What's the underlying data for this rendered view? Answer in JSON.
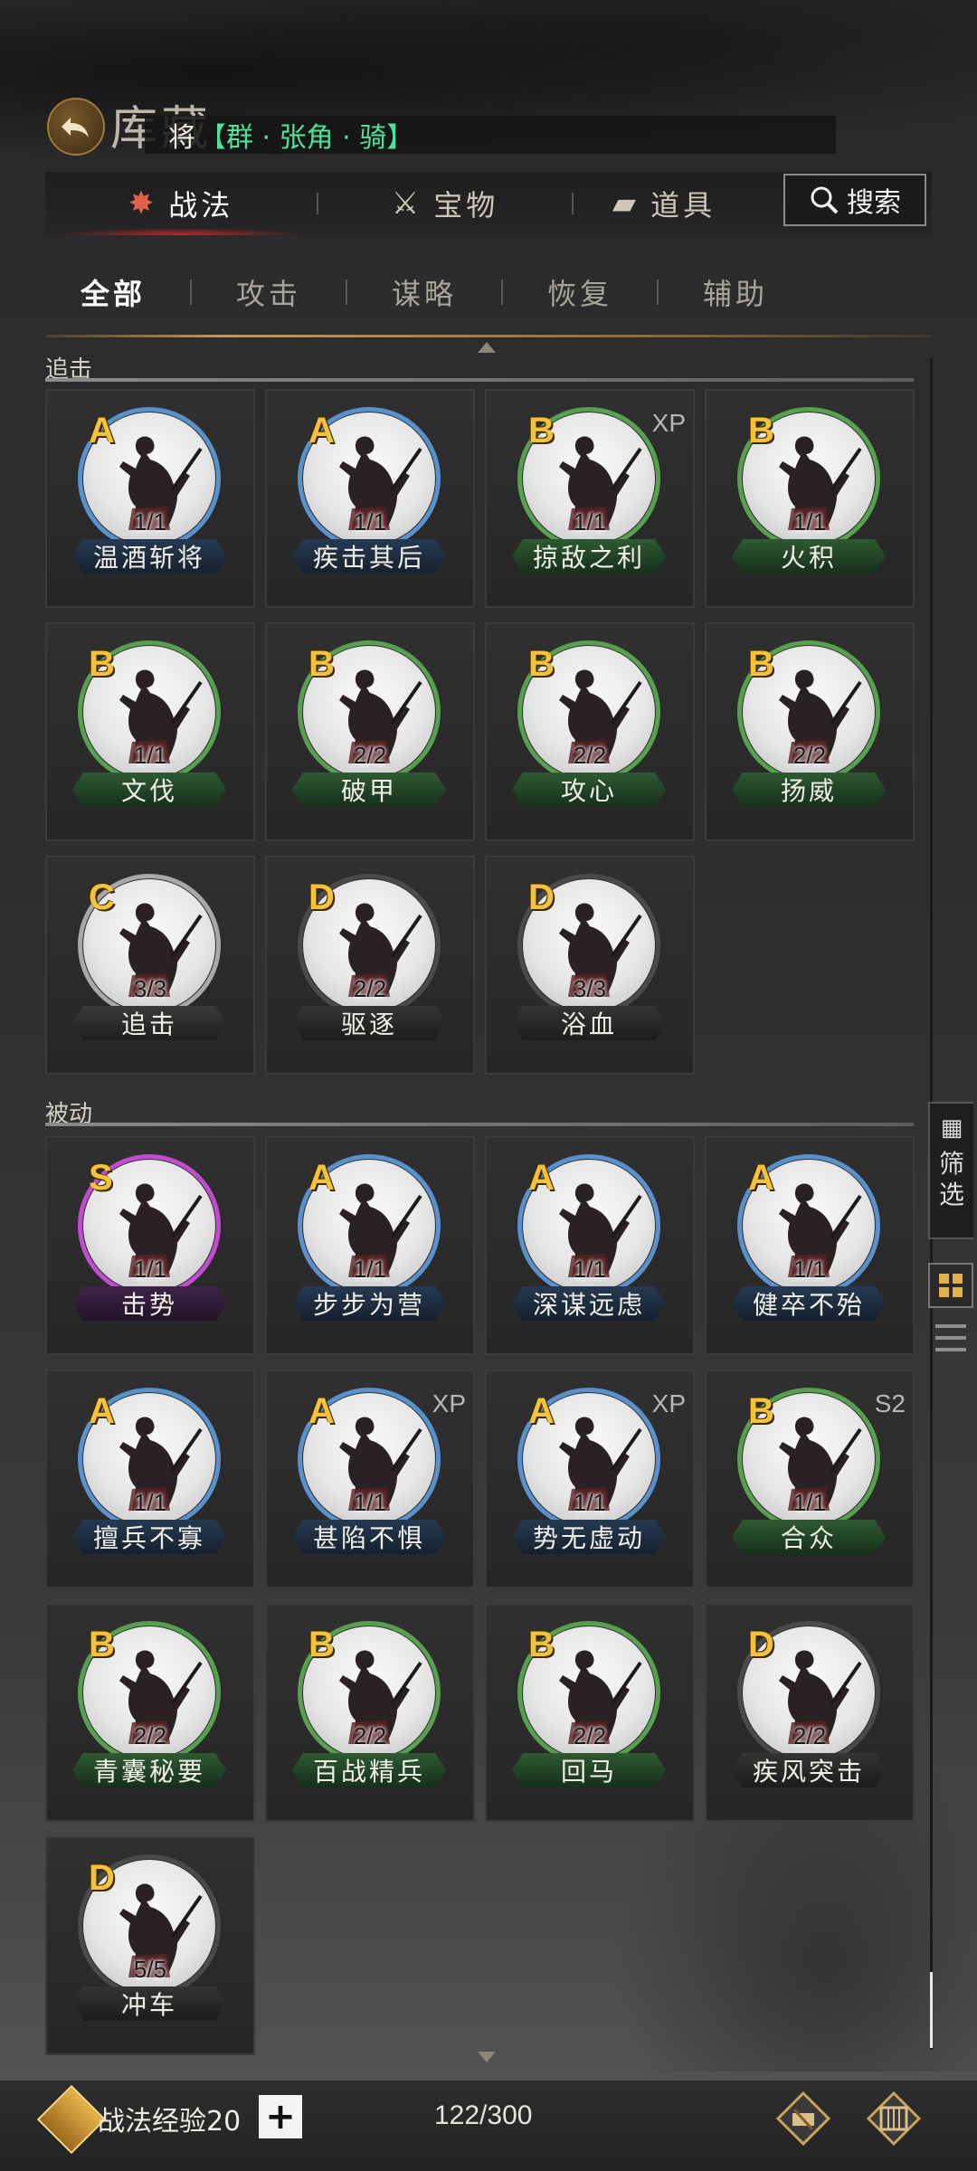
{
  "header": {
    "title": "库藏",
    "general_prefix": "将",
    "general_faction": "【群 · 张角 · 骑】"
  },
  "category_tabs": [
    {
      "label": "战法",
      "icon": "scroll-icon",
      "active": true
    },
    {
      "label": "宝物",
      "icon": "treasure-icon",
      "active": false
    },
    {
      "label": "道具",
      "icon": "item-box-icon",
      "active": false
    }
  ],
  "search": {
    "label": "搜索",
    "icon": "search-icon"
  },
  "filter_tabs": [
    {
      "label": "全部",
      "active": true
    },
    {
      "label": "攻击",
      "active": false
    },
    {
      "label": "谋略",
      "active": false
    },
    {
      "label": "恢复",
      "active": false
    },
    {
      "label": "辅助",
      "active": false
    }
  ],
  "sections": [
    {
      "title": "追击",
      "items": [
        {
          "grade": "A",
          "count": "1/1",
          "name": "温酒斩将",
          "tag": ""
        },
        {
          "grade": "A",
          "count": "1/1",
          "name": "疾击其后",
          "tag": ""
        },
        {
          "grade": "B",
          "count": "1/1",
          "name": "掠敌之利",
          "tag": "XP"
        },
        {
          "grade": "B",
          "count": "1/1",
          "name": "火积",
          "tag": ""
        },
        {
          "grade": "B",
          "count": "1/1",
          "name": "文伐",
          "tag": ""
        },
        {
          "grade": "B",
          "count": "2/2",
          "name": "破甲",
          "tag": ""
        },
        {
          "grade": "B",
          "count": "2/2",
          "name": "攻心",
          "tag": ""
        },
        {
          "grade": "B",
          "count": "2/2",
          "name": "扬威",
          "tag": ""
        },
        {
          "grade": "C",
          "count": "3/3",
          "name": "追击",
          "tag": ""
        },
        {
          "grade": "D",
          "count": "2/2",
          "name": "驱逐",
          "tag": ""
        },
        {
          "grade": "D",
          "count": "3/3",
          "name": "浴血",
          "tag": ""
        }
      ]
    },
    {
      "title": "被动",
      "items": [
        {
          "grade": "S",
          "count": "1/1",
          "name": "击势",
          "tag": ""
        },
        {
          "grade": "A",
          "count": "1/1",
          "name": "步步为营",
          "tag": ""
        },
        {
          "grade": "A",
          "count": "1/1",
          "name": "深谋远虑",
          "tag": ""
        },
        {
          "grade": "A",
          "count": "1/1",
          "name": "健卒不殆",
          "tag": ""
        },
        {
          "grade": "A",
          "count": "1/1",
          "name": "擅兵不寡",
          "tag": ""
        },
        {
          "grade": "A",
          "count": "1/1",
          "name": "甚陷不惧",
          "tag": "XP"
        },
        {
          "grade": "A",
          "count": "1/1",
          "name": "势无虚动",
          "tag": "XP"
        },
        {
          "grade": "B",
          "count": "1/1",
          "name": "合众",
          "tag": "S2"
        },
        {
          "grade": "B",
          "count": "2/2",
          "name": "青囊秘要",
          "tag": ""
        },
        {
          "grade": "B",
          "count": "2/2",
          "name": "百战精兵",
          "tag": ""
        },
        {
          "grade": "B",
          "count": "2/2",
          "name": "回马",
          "tag": ""
        },
        {
          "grade": "D",
          "count": "2/2",
          "name": "疾风突击",
          "tag": ""
        },
        {
          "grade": "D",
          "count": "5/5",
          "name": "冲车",
          "tag": ""
        }
      ]
    }
  ],
  "side": {
    "filter_label": "筛选"
  },
  "footer": {
    "exp_label": "战法经验20",
    "plus_label": "+",
    "capacity": "122/300"
  },
  "colors": {
    "grade_S": "#c24ccf",
    "grade_A": "#5891cc",
    "grade_B": "#57a050",
    "grade_C": "#a8a8a8",
    "grade_D": "#4a4a4a",
    "grade_letter": "#f5c23a",
    "faction_text": "#4fe39a"
  }
}
